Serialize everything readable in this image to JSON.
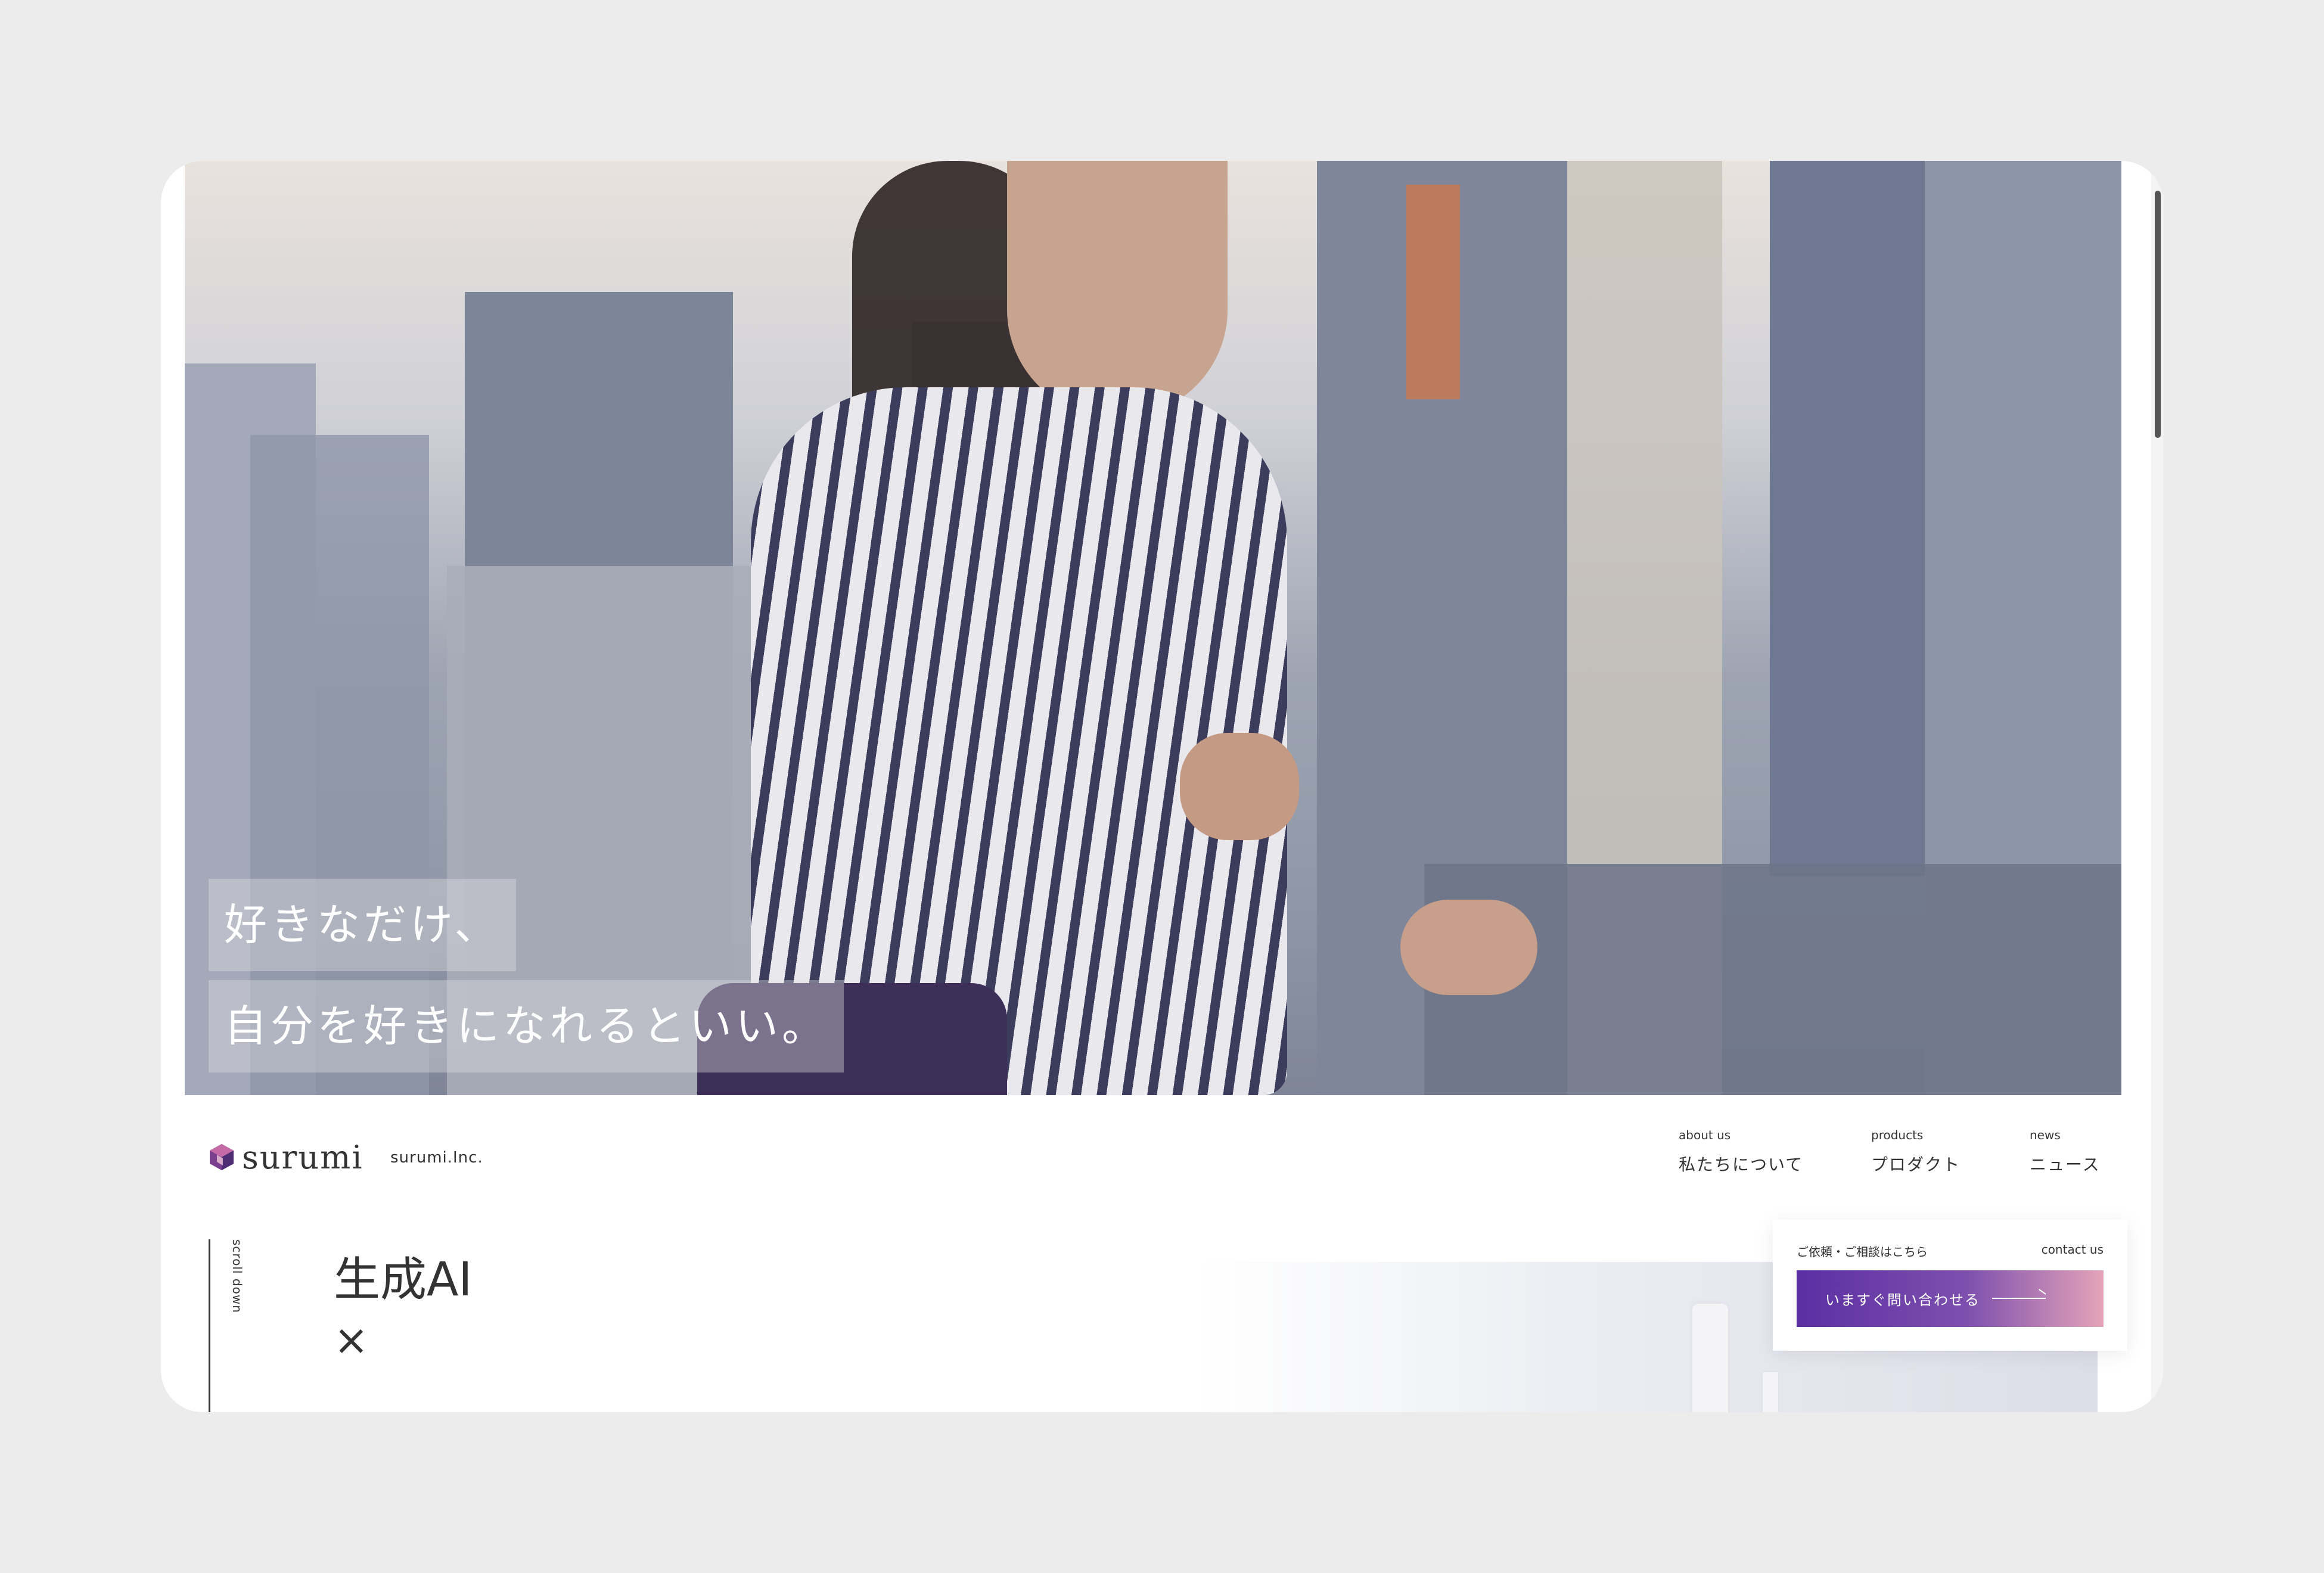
{
  "hero": {
    "tagline_line1": "好きなだけ、",
    "tagline_line2": "自分を好きになれるといい。"
  },
  "header": {
    "logo_text": "surumi",
    "company_name": "surumi.Inc.",
    "nav": [
      {
        "en": "about us",
        "jp": "私たちについて"
      },
      {
        "en": "products",
        "jp": "プロダクト"
      },
      {
        "en": "news",
        "jp": "ニュース"
      }
    ]
  },
  "content": {
    "scroll_label": "scroll down",
    "headline": "生成AI",
    "headline_cross": "×"
  },
  "contact": {
    "caption_left": "ご依頼・ご相談はこちら",
    "caption_right": "contact us",
    "button_label": "いますぐ問い合わせる"
  },
  "colors": {
    "brand_purple": "#5b2fa3",
    "brand_pink": "#e4a3b8",
    "text": "#333333",
    "page_bg": "#ececec"
  },
  "icons": [
    "cube-logo-icon",
    "arrow-right-icon"
  ]
}
